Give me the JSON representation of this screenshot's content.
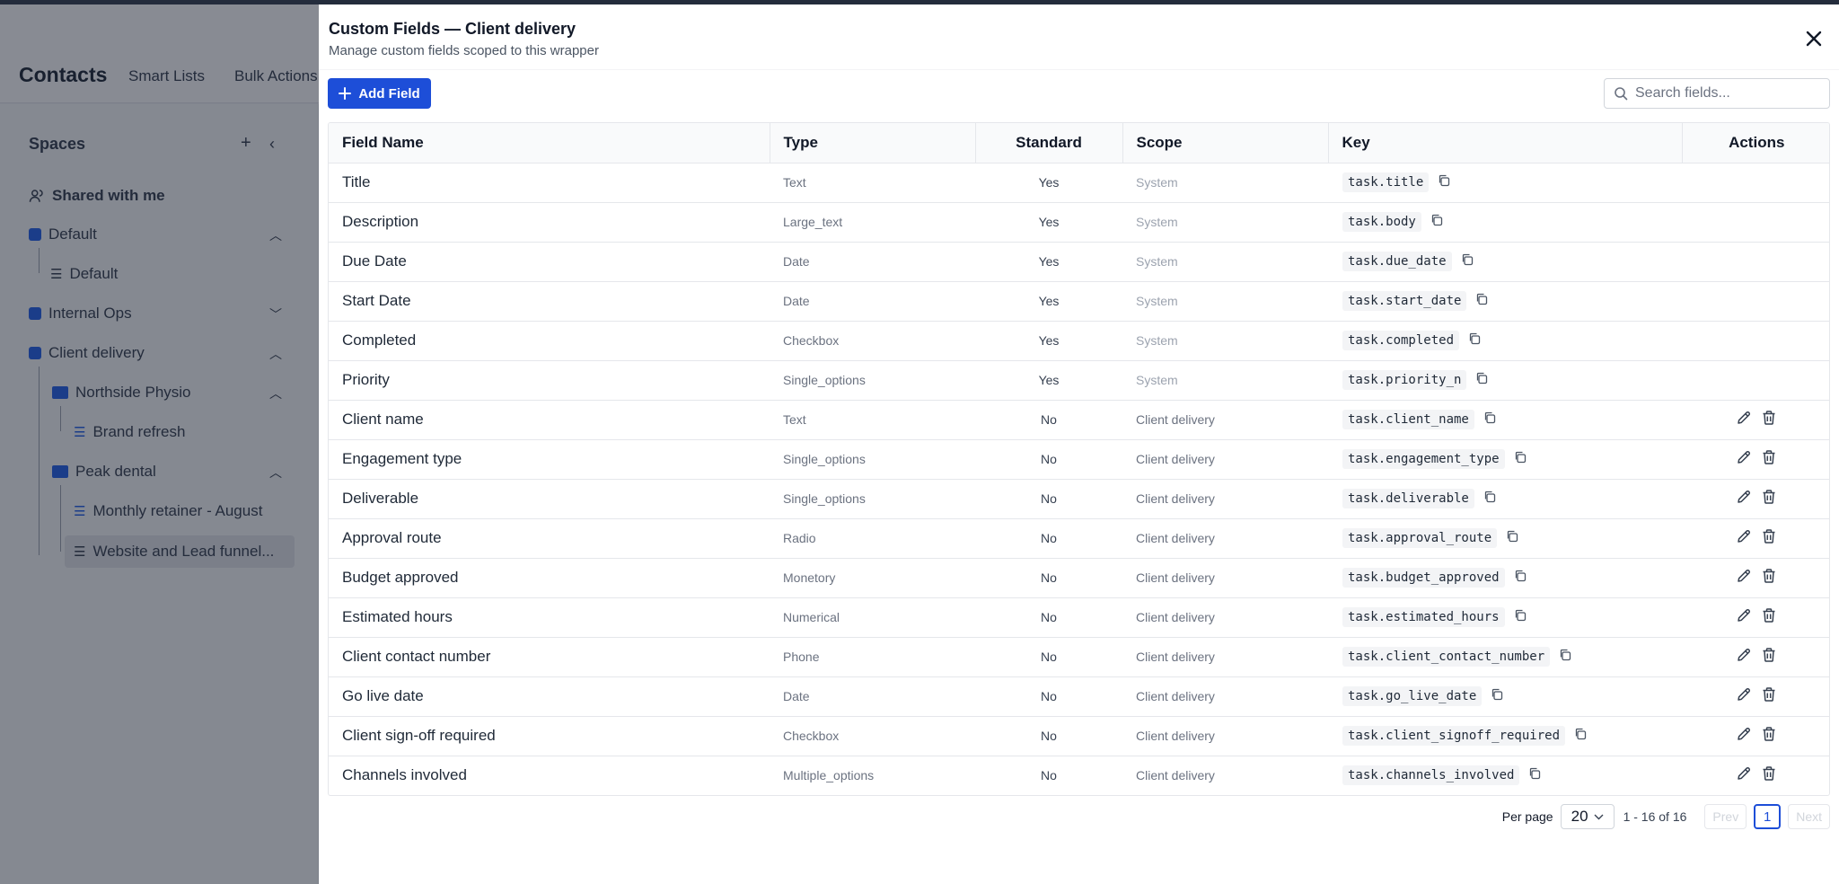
{
  "background": {
    "app_title": "Contacts",
    "tabs": [
      "Smart Lists",
      "Bulk Actions"
    ],
    "sidebar": {
      "heading": "Spaces",
      "shared": "Shared with me",
      "items": {
        "default_space": "Default",
        "default_list": "Default",
        "internal_ops": "Internal Ops",
        "client_delivery": "Client delivery",
        "northside_physio": "Northside Physio",
        "brand_refresh": "Brand refresh",
        "peak_dental": "Peak dental",
        "monthly_retainer": "Monthly retainer - August",
        "website_lead": "Website and Lead funnel..."
      }
    }
  },
  "modal": {
    "title": "Custom Fields — Client delivery",
    "subtitle": "Manage custom fields scoped to this wrapper",
    "add_button": "Add Field",
    "search_placeholder": "Search fields...",
    "columns": {
      "name": "Field Name",
      "type": "Type",
      "standard": "Standard",
      "scope": "Scope",
      "key": "Key",
      "actions": "Actions"
    },
    "rows": [
      {
        "name": "Title",
        "type": "Text",
        "standard": "Yes",
        "scope": "System",
        "key": "task.title",
        "editable": false
      },
      {
        "name": "Description",
        "type": "Large_text",
        "standard": "Yes",
        "scope": "System",
        "key": "task.body",
        "editable": false
      },
      {
        "name": "Due Date",
        "type": "Date",
        "standard": "Yes",
        "scope": "System",
        "key": "task.due_date",
        "editable": false
      },
      {
        "name": "Start Date",
        "type": "Date",
        "standard": "Yes",
        "scope": "System",
        "key": "task.start_date",
        "editable": false
      },
      {
        "name": "Completed",
        "type": "Checkbox",
        "standard": "Yes",
        "scope": "System",
        "key": "task.completed",
        "editable": false
      },
      {
        "name": "Priority",
        "type": "Single_options",
        "standard": "Yes",
        "scope": "System",
        "key": "task.priority_n",
        "editable": false
      },
      {
        "name": "Client name",
        "type": "Text",
        "standard": "No",
        "scope": "Client delivery",
        "key": "task.client_name",
        "editable": true
      },
      {
        "name": "Engagement type",
        "type": "Single_options",
        "standard": "No",
        "scope": "Client delivery",
        "key": "task.engagement_type",
        "editable": true
      },
      {
        "name": "Deliverable",
        "type": "Single_options",
        "standard": "No",
        "scope": "Client delivery",
        "key": "task.deliverable",
        "editable": true
      },
      {
        "name": "Approval route",
        "type": "Radio",
        "standard": "No",
        "scope": "Client delivery",
        "key": "task.approval_route",
        "editable": true
      },
      {
        "name": "Budget approved",
        "type": "Monetory",
        "standard": "No",
        "scope": "Client delivery",
        "key": "task.budget_approved",
        "editable": true
      },
      {
        "name": "Estimated hours",
        "type": "Numerical",
        "standard": "No",
        "scope": "Client delivery",
        "key": "task.estimated_hours",
        "editable": true
      },
      {
        "name": "Client contact number",
        "type": "Phone",
        "standard": "No",
        "scope": "Client delivery",
        "key": "task.client_contact_number",
        "editable": true
      },
      {
        "name": "Go live date",
        "type": "Date",
        "standard": "No",
        "scope": "Client delivery",
        "key": "task.go_live_date",
        "editable": true
      },
      {
        "name": "Client sign-off required",
        "type": "Checkbox",
        "standard": "No",
        "scope": "Client delivery",
        "key": "task.client_signoff_required",
        "editable": true
      },
      {
        "name": "Channels involved",
        "type": "Multiple_options",
        "standard": "No",
        "scope": "Client delivery",
        "key": "task.channels_involved",
        "editable": true
      }
    ],
    "pagination": {
      "per_page_label": "Per page",
      "per_page_value": "20",
      "range": "1 - 16 of 16",
      "prev": "Prev",
      "page": "1",
      "next": "Next"
    }
  }
}
